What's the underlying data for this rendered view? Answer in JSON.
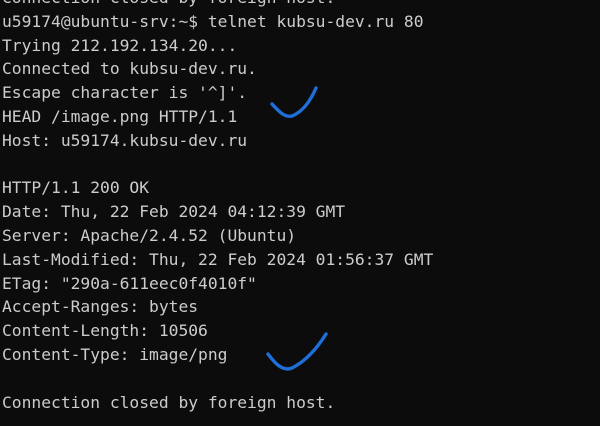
{
  "terminal": {
    "lines": [
      "Connection closed by foreign host.",
      "u59174@ubuntu-srv:~$ telnet kubsu-dev.ru 80",
      "Trying 212.192.134.20...",
      "Connected to kubsu-dev.ru.",
      "Escape character is '^]'.",
      "HEAD /image.png HTTP/1.1",
      "Host: u59174.kubsu-dev.ru",
      "",
      "HTTP/1.1 200 OK",
      "Date: Thu, 22 Feb 2024 04:12:39 GMT",
      "Server: Apache/2.4.52 (Ubuntu)",
      "Last-Modified: Thu, 22 Feb 2024 01:56:37 GMT",
      "ETag: \"290a-611eec0f4010f\"",
      "Accept-Ranges: bytes",
      "Content-Length: 10506",
      "Content-Type: image/png",
      "",
      "Connection closed by foreign host."
    ]
  },
  "annotations": {
    "color": "#1e6fd9",
    "marks": [
      "checkmark",
      "checkmark"
    ]
  },
  "colors": {
    "background": "#0c0c0c",
    "text": "#cccccc"
  }
}
